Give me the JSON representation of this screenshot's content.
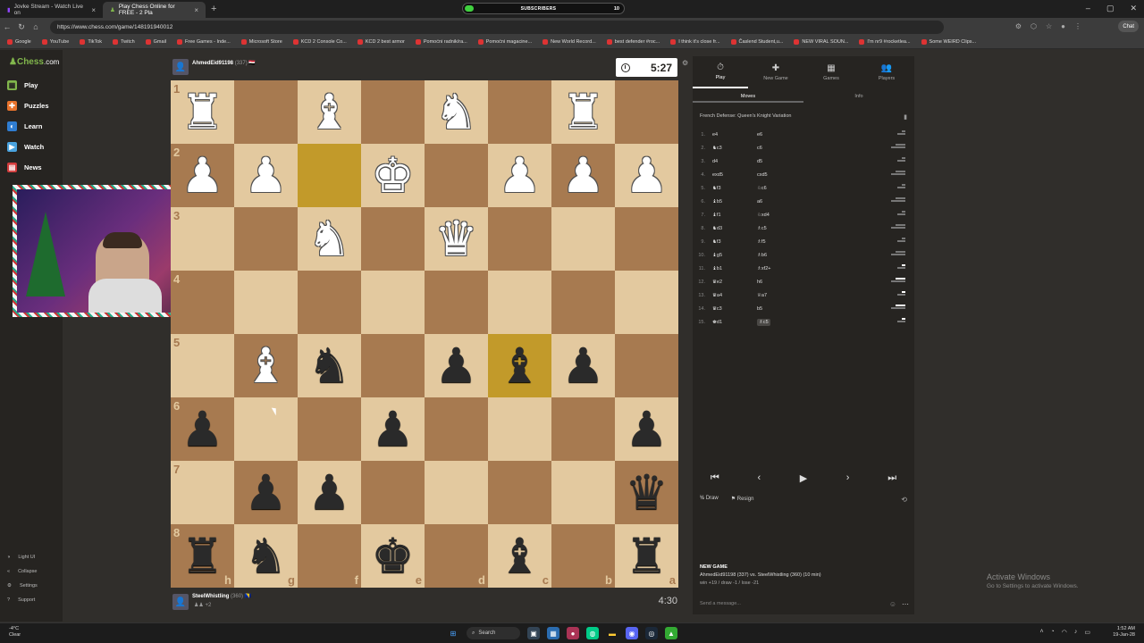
{
  "browser": {
    "tabs": [
      {
        "label": "Jovke Stream - Watch Live on"
      },
      {
        "label": "Play Chess Online for FREE - 2 Pla"
      }
    ],
    "url": "https://www.chess.com/game/148191940012",
    "subscribers_label": "SUBSCRIBERS",
    "subscribers_count": "10",
    "chat_button": "Chat",
    "bookmarks": [
      "Google",
      "YouTube",
      "TikTok",
      "Twitch",
      "Gmail",
      "Free Games - Inde...",
      "Microsoft Store",
      "KCD 2 Console Co...",
      "KCD 2 best armor",
      "Pomoćni radnik/ra...",
      "Pomoćni magacine...",
      "New World Record...",
      "best defender #roc...",
      "I think it's close fr...",
      "Časlend Student,u...",
      "NEW VIRAL SOUN...",
      "I'm nr9 #rocketlea...",
      "Some WEIRD Clips..."
    ]
  },
  "sidebar": {
    "logo": "Chess",
    "logo_suffix": ".com",
    "items": [
      "Play",
      "Puzzles",
      "Learn",
      "Watch",
      "News"
    ],
    "bottom": [
      "Light UI",
      "Collapse",
      "Settings",
      "Support"
    ]
  },
  "top_player": {
    "name": "AhmedEid91198",
    "rating": "(337)",
    "flag": "🇪🇬",
    "clock": "5:27"
  },
  "bottom_player": {
    "name": "SteelWhistling",
    "rating": "(360)",
    "flag": "🇧🇦",
    "clock": "4:30",
    "captured": "+2"
  },
  "board": {
    "ranks": [
      "1",
      "2",
      "3",
      "4",
      "5",
      "6",
      "7",
      "8"
    ],
    "files": [
      "h",
      "g",
      "f",
      "e",
      "d",
      "c",
      "b",
      "a"
    ],
    "squares": [
      [
        "wR",
        "",
        "wB",
        "",
        "wN",
        "",
        "wR",
        ""
      ],
      [
        "wP",
        "wP",
        "",
        "wK",
        "",
        "wP",
        "wP",
        "wP"
      ],
      [
        "",
        "",
        "wN",
        "",
        "wQ",
        "",
        "",
        ""
      ],
      [
        "",
        "",
        "",
        "",
        "",
        "",
        "",
        ""
      ],
      [
        "",
        "wB",
        "bN",
        "",
        "bP",
        "bB",
        "bP",
        ""
      ],
      [
        "bP",
        "",
        "",
        "bP",
        "",
        "",
        "",
        "bP"
      ],
      [
        "",
        "bP",
        "bP",
        "",
        "",
        "",
        "",
        "bQ"
      ],
      [
        "bR",
        "bN",
        "",
        "bK",
        "",
        "bB",
        "",
        "bR"
      ]
    ],
    "highlighted": [
      [
        1,
        2
      ],
      [
        4,
        5
      ]
    ]
  },
  "panel": {
    "tabs": [
      {
        "label": "Play",
        "icon": "⏱"
      },
      {
        "label": "New Game",
        "icon": "✚"
      },
      {
        "label": "Games",
        "icon": "▦"
      },
      {
        "label": "Players",
        "icon": "👥"
      }
    ],
    "subtabs": [
      "Moves",
      "Info"
    ],
    "opening": "French Defense: Queen's Knight Variation",
    "moves": [
      {
        "n": "1.",
        "w": "e4",
        "b": "e6"
      },
      {
        "n": "2.",
        "w": "♞c3",
        "b": "c6"
      },
      {
        "n": "3.",
        "w": "d4",
        "b": "d5"
      },
      {
        "n": "4.",
        "w": "exd5",
        "b": "cxd5"
      },
      {
        "n": "5.",
        "w": "♞f3",
        "b": "♘c6"
      },
      {
        "n": "6.",
        "w": "♝b5",
        "b": "a6"
      },
      {
        "n": "7.",
        "w": "♝f1",
        "b": "♘xd4"
      },
      {
        "n": "8.",
        "w": "♞d3",
        "b": "♗c5"
      },
      {
        "n": "9.",
        "w": "♞f3",
        "b": "♗f5"
      },
      {
        "n": "10.",
        "w": "♝g5",
        "b": "♗b6"
      },
      {
        "n": "11.",
        "w": "♝b1",
        "b": "♗xf2+"
      },
      {
        "n": "12.",
        "w": "♛e2",
        "b": "h6"
      },
      {
        "n": "13.",
        "w": "♛a4",
        "b": "♕a7"
      },
      {
        "n": "14.",
        "w": "♛c3",
        "b": "b5"
      },
      {
        "n": "15.",
        "w": "♚d1",
        "b": "♗c5"
      }
    ],
    "controls": [
      "⏮",
      "‹",
      "▶",
      "›",
      "⏭"
    ],
    "draw_label": "Draw",
    "draw_icon": "½",
    "resign_label": "Resign",
    "resign_icon": "⚑",
    "new_game_title": "NEW GAME",
    "new_game_line": "AhmedEid91198 (337) vs. SteelWhistling (360) (10 min)",
    "new_game_stats": "win +19 / draw -1 / lose -21",
    "chat_placeholder": "Send a message..."
  },
  "activate": {
    "title": "Activate Windows",
    "sub": "Go to Settings to activate Windows."
  },
  "taskbar": {
    "temp": "-4°C",
    "weather": "Clear",
    "search": "Search",
    "time": "1:52 AM",
    "date": "19-Jan-28"
  }
}
